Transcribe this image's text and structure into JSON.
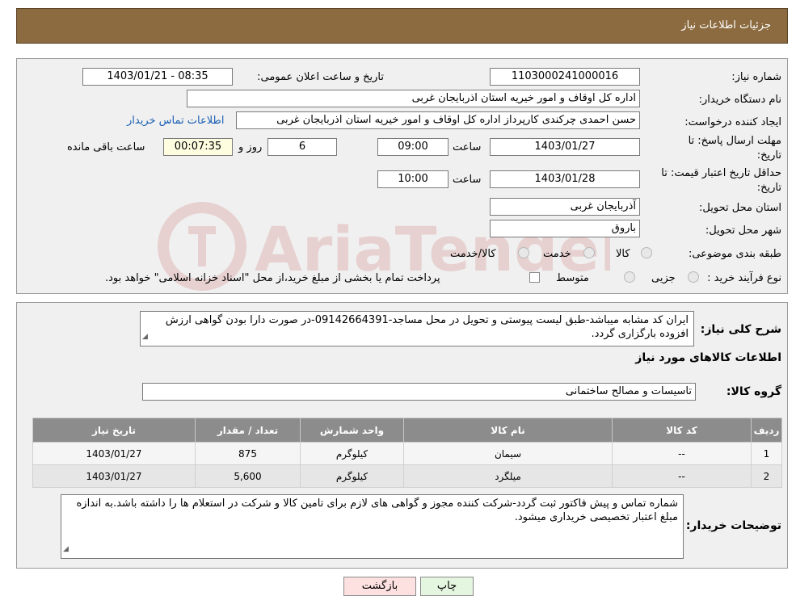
{
  "header": {
    "title": "جزئیات اطلاعات نیاز"
  },
  "info": {
    "need_number_label": "شماره نیاز:",
    "need_number": "1103000241000016",
    "announce_label": "تاریخ و ساعت اعلان عمومی:",
    "announce_value": "1403/01/21 - 08:35",
    "buyer_label": "نام دستگاه خریدار:",
    "buyer_value": "اداره کل اوقاف و امور خیریه استان اذربایجان غربی",
    "creator_label": "ایجاد کننده درخواست:",
    "creator_value": "حسن احمدی چرکندی کارپرداز اداره کل اوقاف و امور خیریه استان اذربایجان غربی",
    "contact_link": "اطلاعات تماس خریدار",
    "deadline_label_1": "مهلت ارسال پاسخ: تا",
    "deadline_label_2": "تاریخ:",
    "deadline_date": "1403/01/27",
    "time_label": "ساعت",
    "deadline_time": "09:00",
    "days_value": "6",
    "days_label": "روز و",
    "remaining_time": "00:07:35",
    "remaining_label": "ساعت باقی مانده",
    "validity_label_1": "حداقل تاریخ اعتبار قیمت: تا",
    "validity_label_2": "تاریخ:",
    "validity_date": "1403/01/28",
    "validity_time": "10:00",
    "province_label": "استان محل تحویل:",
    "province_value": "آذربایجان غربی",
    "city_label": "شهر محل تحویل:",
    "city_value": "باروق",
    "category_label": "طبقه بندی موضوعی:",
    "cat_goods": "کالا",
    "cat_service": "خدمت",
    "cat_both": "کالا/خدمت",
    "process_label": "نوع فرآیند خرید :",
    "proc_partial": "جزیی",
    "proc_medium": "متوسط",
    "payment_note": "پرداخت تمام یا بخشی از مبلغ خرید،از محل \"اسناد خزانه اسلامی\" خواهد بود."
  },
  "details": {
    "desc_label": "شرح کلی نیاز:",
    "desc_text": "ایران کد مشابه میباشد-طبق لیست پیوستی و تحویل در محل مساجد-09142664391-در صورت دارا بودن گواهی ارزش افزوده بارگزاری گردد.",
    "goods_info_title": "اطلاعات کالاهای مورد نیاز",
    "group_label": "گروه کالا:",
    "group_value": "تاسیسات و مصالح ساختمانی"
  },
  "table": {
    "headers": [
      "ردیف",
      "کد کالا",
      "نام کالا",
      "واحد شمارش",
      "تعداد / مقدار",
      "تاریخ نیاز"
    ],
    "rows": [
      [
        "1",
        "--",
        "سیمان",
        "کیلوگرم",
        "875",
        "1403/01/27"
      ],
      [
        "2",
        "--",
        "میلگرد",
        "کیلوگرم",
        "5,600",
        "1403/01/27"
      ]
    ]
  },
  "buyer_notes": {
    "label": "توضیحات خریدار:",
    "text": "شماره تماس و پیش فاکتور ثبت گردد-شرکت کننده مجوز و گواهی های لازم برای تامین کالا و شرکت در استعلام ها را داشته باشد.به اندازه مبلغ اعتبار تخصیصی خریداری میشود."
  },
  "buttons": {
    "print": "چاپ",
    "back": "بازگشت"
  },
  "watermark": {
    "text": "AriaTender.neT"
  },
  "colors": {
    "header_bg": "#8b6b3f",
    "link": "#1a5fb4",
    "back_button": "#fde0e0",
    "print_button": "#e4f6df"
  }
}
